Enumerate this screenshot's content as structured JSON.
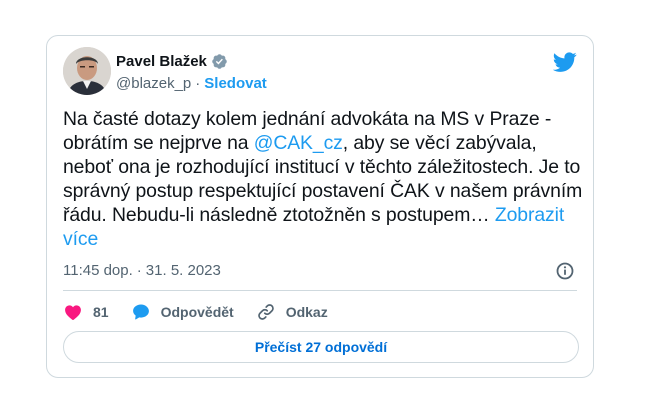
{
  "author": {
    "name": "Pavel Blažek",
    "handle": "@blazek_p",
    "separator": "·",
    "follow_label": "Sledovat"
  },
  "tweet": {
    "text_part1": "Na časté dotazy kolem jednání advokáta na MS v Praze - obrátím se nejprve na ",
    "mention": "@CAK_cz",
    "text_part2": ", aby se věcí zabývala, neboť ona je rozhodující institucí v těchto záležitostech. Je to správný postup respektující postavení ČAK v našem právním řádu. Nebudu-li následně ztotožněn s postupem… ",
    "show_more": "Zobrazit více"
  },
  "meta": {
    "time": "11:45 dop.",
    "separator": "·",
    "date": "31. 5. 2023"
  },
  "actions": {
    "likes_count": "81",
    "reply_label": "Odpovědět",
    "link_label": "Odkaz"
  },
  "read_replies_label": "Přečíst 27 odpovědí",
  "colors": {
    "accent": "#1d9bf0",
    "like": "#f91880",
    "secondary_text": "#536471",
    "border": "#cfd9de"
  },
  "icons": {
    "verified": "verified-badge-icon",
    "brand": "twitter-bird-icon",
    "info": "info-icon",
    "like": "heart-icon",
    "reply": "speech-bubble-icon",
    "link": "link-icon"
  }
}
